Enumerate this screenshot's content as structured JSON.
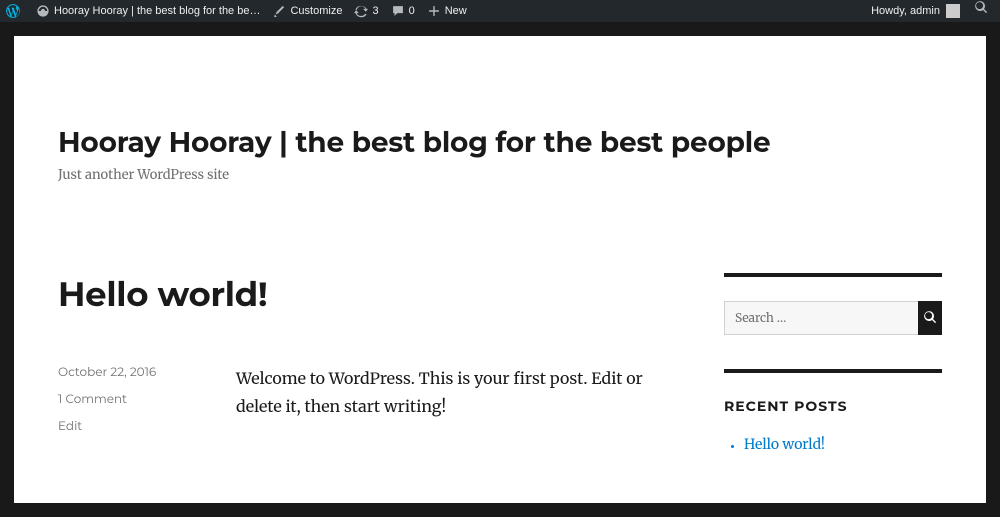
{
  "adminbar": {
    "site_name": "Hooray Hooray | the best blog for the be…",
    "customize": "Customize",
    "updates_count": "3",
    "comments_count": "0",
    "new_label": "New",
    "howdy": "Howdy, admin"
  },
  "header": {
    "title": "Hooray Hooray | the best blog for the best people",
    "tagline": "Just another WordPress site"
  },
  "post": {
    "title": "Hello world!",
    "date": "October 22, 2016",
    "comments": "1 Comment",
    "edit": "Edit",
    "excerpt": "Welcome to WordPress. This is your first post. Edit or delete it, then start writing!"
  },
  "sidebar": {
    "search_placeholder": "Search …",
    "recent_title": "RECENT POSTS",
    "recent_items": [
      "Hello world!"
    ]
  }
}
